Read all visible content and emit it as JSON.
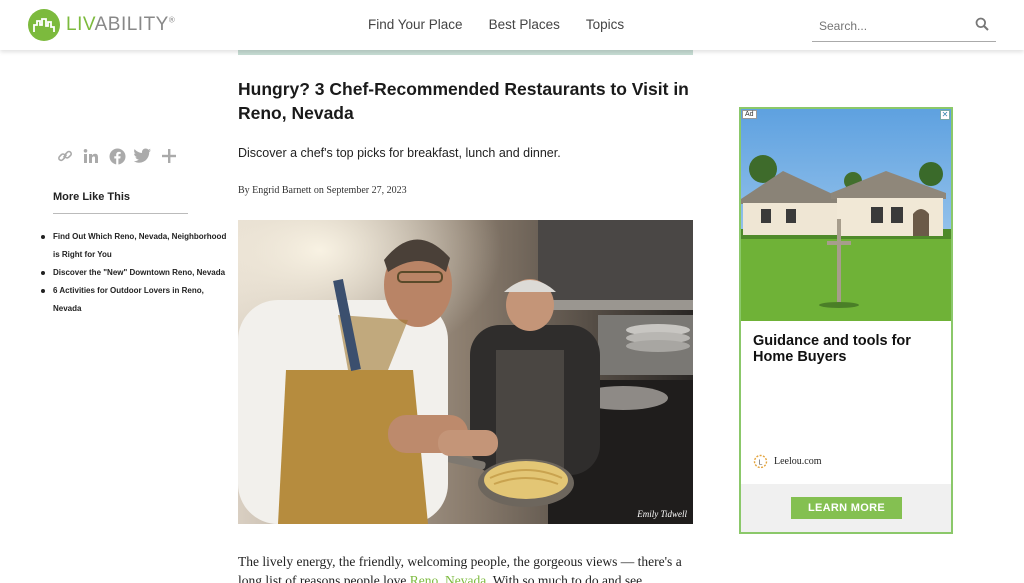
{
  "header": {
    "logo_text_a": "LIV",
    "logo_text_b": "ABILITY",
    "logo_reg": "®",
    "nav": [
      "Find Your Place",
      "Best Places",
      "Topics"
    ],
    "search_placeholder": "Search..."
  },
  "share_icons": [
    "link-icon",
    "linkedin-icon",
    "facebook-icon",
    "twitter-icon",
    "plus-icon"
  ],
  "sidebar": {
    "title": "More Like This",
    "links": [
      "Find Out Which Reno, Nevada, Neighborhood is Right for You",
      "Discover the \"New\" Downtown Reno, Nevada",
      "6 Activities for Outdoor Lovers in Reno, Nevada"
    ]
  },
  "article": {
    "headline": "Hungry? 3 Chef-Recommended Restaurants to Visit in Reno, Nevada",
    "deck": "Discover a chef's top picks for breakfast, lunch and dinner.",
    "byline": "By Engrid Barnett on September 27, 2023",
    "photo_credit": "Emily Tidwell",
    "body_before": "The lively energy, the friendly, welcoming people, the gorgeous views — there's a long list of reasons people love ",
    "body_link_1": "Reno",
    "body_sep": ", ",
    "body_link_2": "Nevada",
    "body_after": ". With so much to do and see,"
  },
  "ad": {
    "badge": "Ad",
    "close": "✕",
    "headline": "Guidance and tools for Home Buyers",
    "brand": "Leelou.com",
    "cta": "LEARN MORE"
  },
  "colors": {
    "brand_green": "#7cba3d",
    "ad_border": "#8bc86a",
    "cta_green": "#84c051"
  }
}
